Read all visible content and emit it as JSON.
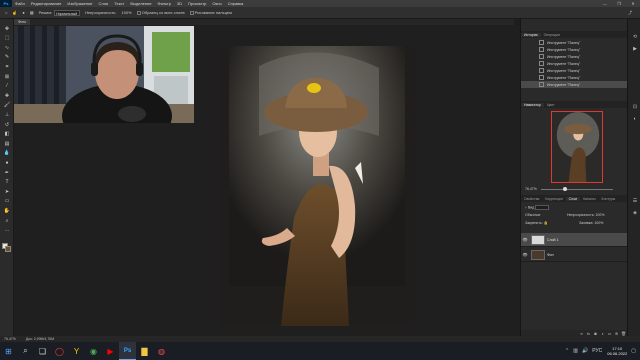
{
  "app": {
    "logo": "Ps"
  },
  "menu": [
    "Файл",
    "Редактирование",
    "Изображение",
    "Слои",
    "Текст",
    "Выделение",
    "Фильтр",
    "3D",
    "Просмотр",
    "Окно",
    "Справка"
  ],
  "window_controls": {
    "minimize": "—",
    "maximize": "❐",
    "close": "✕"
  },
  "options_bar": {
    "mode_label": "Режим:",
    "mode_value": "Нормальный",
    "opacity_label": "Непрозрачность:",
    "opacity_value": "100%",
    "sample_all_label": "Образец со всех слоев",
    "finger_label": "Рисование пальцем"
  },
  "document_tab": {
    "title": "Фото"
  },
  "toolbar": {
    "tools": [
      {
        "name": "move-tool-icon",
        "glyph": "✥"
      },
      {
        "name": "marquee-tool-icon",
        "glyph": "⬚"
      },
      {
        "name": "lasso-tool-icon",
        "glyph": "∿"
      },
      {
        "name": "quick-select-tool-icon",
        "glyph": "✎"
      },
      {
        "name": "crop-tool-icon",
        "glyph": "⌗"
      },
      {
        "name": "frame-tool-icon",
        "glyph": "⊠"
      },
      {
        "name": "eyedropper-tool-icon",
        "glyph": "⁄"
      },
      {
        "name": "healing-tool-icon",
        "glyph": "✚"
      },
      {
        "name": "brush-tool-icon",
        "glyph": "🖌"
      },
      {
        "name": "stamp-tool-icon",
        "glyph": "⊥"
      },
      {
        "name": "history-brush-tool-icon",
        "glyph": "↺"
      },
      {
        "name": "eraser-tool-icon",
        "glyph": "◧"
      },
      {
        "name": "gradient-tool-icon",
        "glyph": "▤"
      },
      {
        "name": "blur-tool-icon",
        "glyph": "💧"
      },
      {
        "name": "dodge-tool-icon",
        "glyph": "●"
      },
      {
        "name": "pen-tool-icon",
        "glyph": "✒"
      },
      {
        "name": "type-tool-icon",
        "glyph": "T"
      },
      {
        "name": "path-select-tool-icon",
        "glyph": "➤"
      },
      {
        "name": "shape-tool-icon",
        "glyph": "▭"
      },
      {
        "name": "hand-tool-icon",
        "glyph": "✋"
      },
      {
        "name": "zoom-tool-icon",
        "glyph": "⌕"
      },
      {
        "name": "more-tools-icon",
        "glyph": "…"
      }
    ]
  },
  "history_panel": {
    "tabs": [
      "История",
      "Операции"
    ],
    "items": [
      "Инструмент \"Палец\"",
      "Инструмент \"Палец\"",
      "Инструмент \"Палец\"",
      "Инструмент \"Палец\"",
      "Инструмент \"Палец\"",
      "Инструмент \"Палец\"",
      "Инструмент \"Палец\""
    ]
  },
  "navigator_panel": {
    "tabs": [
      "Навигатор",
      "Цвет"
    ],
    "zoom": "76,47%"
  },
  "layers_panel": {
    "tabs": [
      "Свойства",
      "Коррекция",
      "Слои",
      "Каналы",
      "Контуры"
    ],
    "kind_label": "Вид",
    "blend_mode": "Обычные",
    "opacity_label": "Непрозрачность:",
    "opacity_value": "100%",
    "lock_label": "Закрепить:",
    "fill_label": "Заливка:",
    "fill_value": "100%",
    "layers": [
      {
        "name": "Слой 1",
        "eye": "👁"
      },
      {
        "name": "Фон",
        "eye": "👁"
      }
    ]
  },
  "status_bar": {
    "zoom": "76,47%",
    "doc_info": "Док: 2,99M/4,76M"
  },
  "taskbar": {
    "apps": [
      {
        "name": "start-icon",
        "glyph": "⊞",
        "color": "#4fa3ff"
      },
      {
        "name": "search-icon",
        "glyph": "⌕",
        "color": "#d8d8d8"
      },
      {
        "name": "task-view-icon",
        "glyph": "❏",
        "color": "#d8d8d8"
      },
      {
        "name": "opera-icon",
        "glyph": "◯",
        "color": "#ff3b3b"
      },
      {
        "name": "yandex-icon",
        "glyph": "Y",
        "color": "#ffcc00"
      },
      {
        "name": "chrome-icon",
        "glyph": "◉",
        "color": "#4caf50"
      },
      {
        "name": "youtube-icon",
        "glyph": "▶",
        "color": "#ff0000"
      },
      {
        "name": "photoshop-icon",
        "glyph": "Ps",
        "color": "#31a8ff"
      },
      {
        "name": "explorer-icon",
        "glyph": "▇",
        "color": "#f4c542"
      },
      {
        "name": "app-icon",
        "glyph": "◍",
        "color": "#e05050"
      }
    ],
    "lang": "РУС",
    "time": "17:10",
    "date": "06.06.2022"
  },
  "colors": {
    "foreground_swatch": "#f2e6c9",
    "background_swatch": "#6b4f2a",
    "navigator_frame": "#e03a2e"
  }
}
